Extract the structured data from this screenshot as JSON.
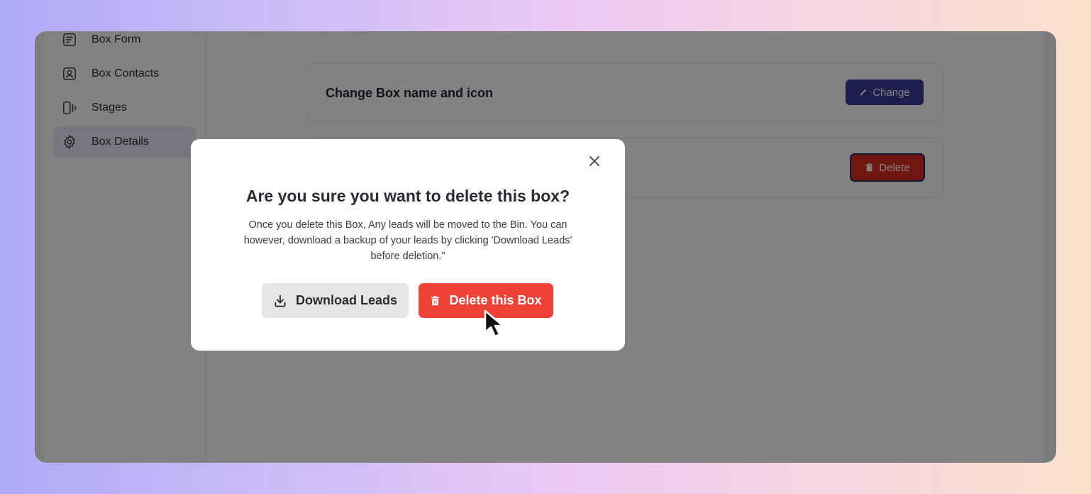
{
  "sidebar": {
    "items": [
      {
        "label": "Box Form",
        "icon": "form-icon",
        "active": false
      },
      {
        "label": "Box Contacts",
        "icon": "contact-icon",
        "active": false
      },
      {
        "label": "Stages",
        "icon": "stages-icon",
        "active": false
      },
      {
        "label": "Box Details",
        "icon": "gear-icon",
        "active": true
      }
    ]
  },
  "main": {
    "rename_card": {
      "title": "Change Box name and icon",
      "button_label": "Change",
      "button_icon": "pencil-icon"
    },
    "delete_card": {
      "button_label": "Delete",
      "button_icon": "trash-icon"
    }
  },
  "modal": {
    "title": "Are you sure you want to delete this box?",
    "body": "Once you delete this Box, Any leads will be moved to the Bin. You can however, download a backup of your leads by clicking 'Download Leads' before deletion.\"",
    "download_label": "Download Leads",
    "download_icon": "download-icon",
    "delete_label": "Delete this Box",
    "delete_icon": "trash-icon",
    "close_icon": "close-icon"
  },
  "colors": {
    "accent": "#3a3a9a",
    "danger": "#ef4236",
    "overlay": "rgba(0,0,0,0.49)"
  }
}
